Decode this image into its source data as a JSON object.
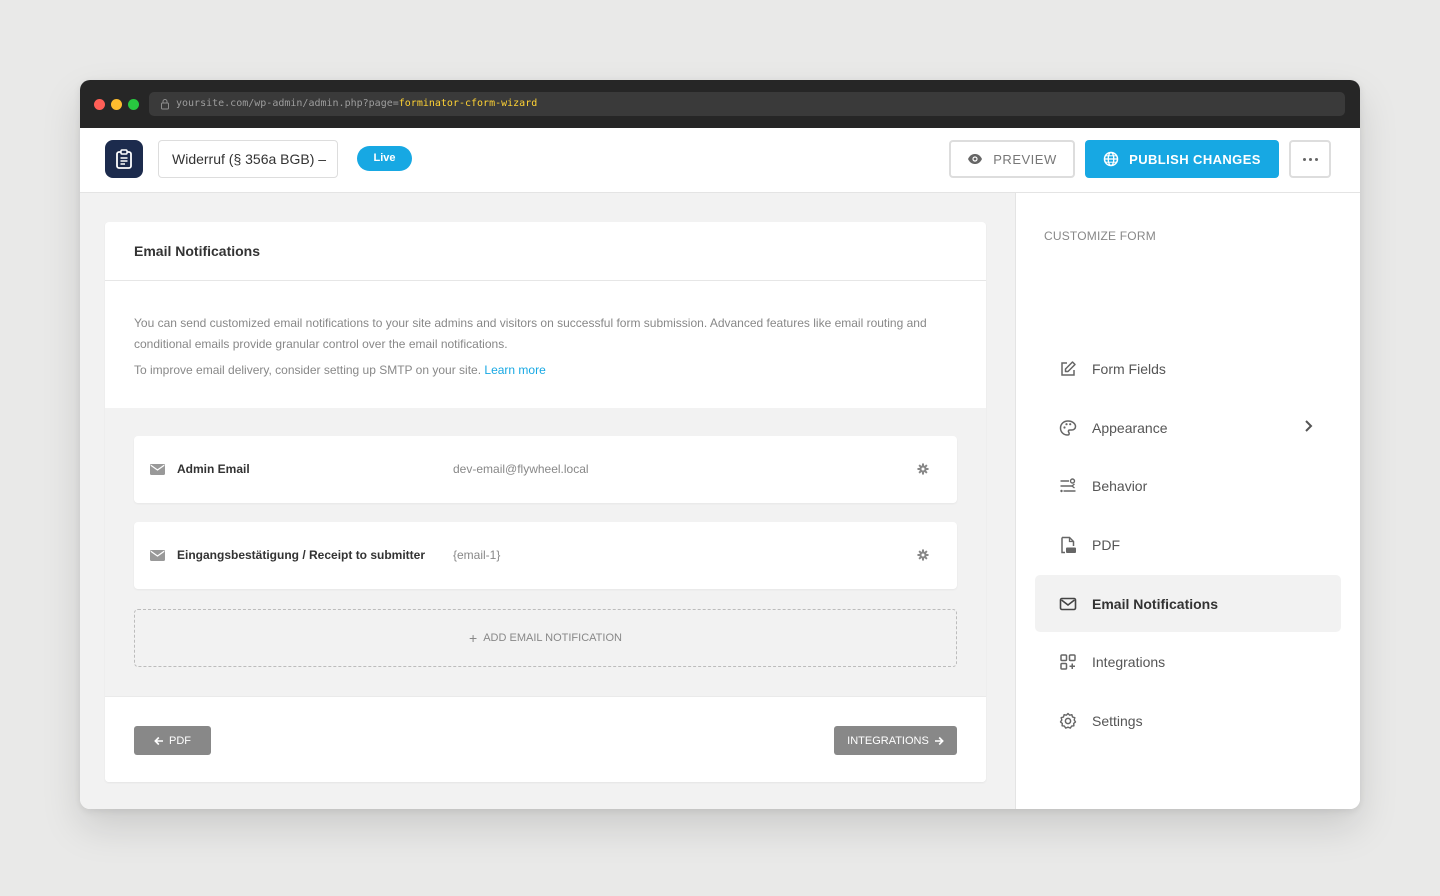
{
  "browser": {
    "url_prefix": "yoursite.com/wp-admin/admin.php?page=",
    "url_highlight": "forminator-cform-wizard"
  },
  "header": {
    "form_name": "Widerruf (§ 356a BGB) –",
    "status_badge": "Live",
    "preview_label": "PREVIEW",
    "publish_label": "PUBLISH CHANGES",
    "accent_color": "#17a8e3"
  },
  "panel": {
    "title": "Email Notifications",
    "description": "You can send customized email notifications to your site admins and visitors on successful form submission. Advanced features like email routing and conditional emails provide granular control over the email notifications.",
    "smtp_note": "To improve email delivery, consider setting up SMTP on your site.",
    "learn_more": "Learn more",
    "notifications": [
      {
        "name": "Admin Email",
        "recipient": "dev-email@flywheel.local",
        "icon": "mail-icon"
      },
      {
        "name": "Eingangsbestätigung / Receipt to submitter",
        "recipient": "{email-1}",
        "icon": "mail-icon"
      }
    ],
    "add_label": "ADD EMAIL NOTIFICATION",
    "prev_label": "PDF",
    "next_label": "INTEGRATIONS"
  },
  "sidebar": {
    "title": "CUSTOMIZE FORM",
    "items": [
      {
        "label": "Form Fields",
        "icon": "edit-icon"
      },
      {
        "label": "Appearance",
        "icon": "palette-icon"
      },
      {
        "label": "Behavior",
        "icon": "behavior-icon"
      },
      {
        "label": "PDF",
        "icon": "pdf-icon"
      },
      {
        "label": "Email Notifications",
        "icon": "envelope-icon",
        "active": true
      },
      {
        "label": "Integrations",
        "icon": "integrations-icon"
      },
      {
        "label": "Settings",
        "icon": "settings-icon"
      }
    ]
  }
}
